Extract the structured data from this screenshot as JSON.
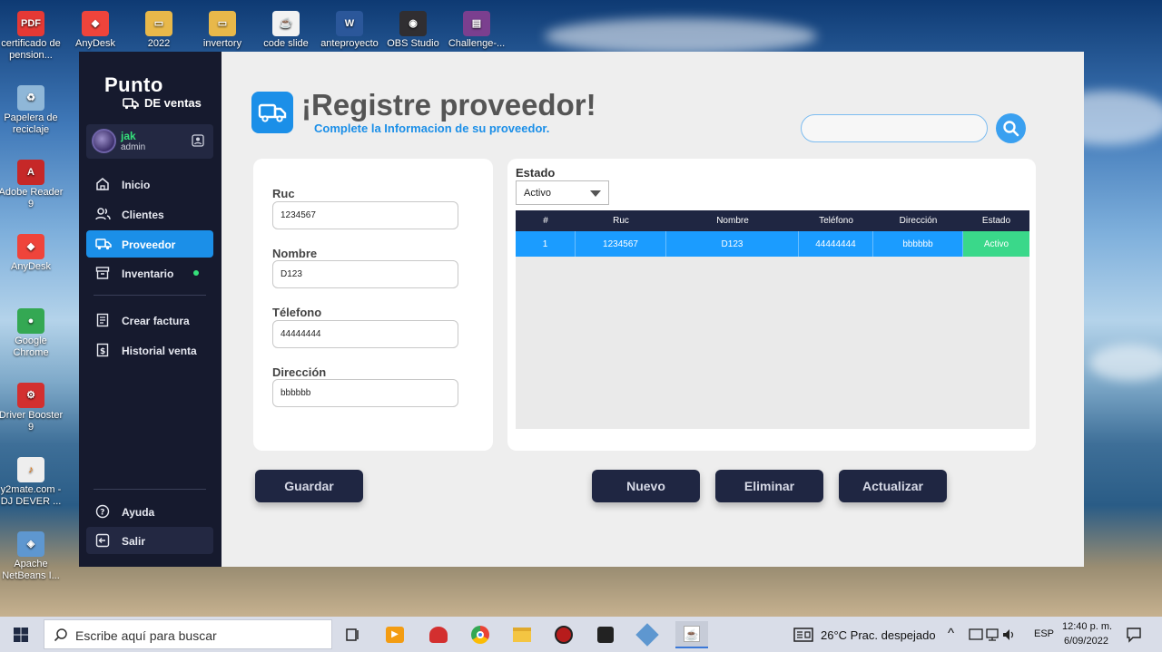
{
  "desktop_icons": [
    {
      "label": "certificado de pension...",
      "icon": "pdf-icon",
      "color": "#e53935",
      "glyph": "PDF"
    },
    {
      "label": "AnyDesk",
      "icon": "anydesk-icon",
      "color": "#ef443b",
      "glyph": "◆"
    },
    {
      "label": "2022",
      "icon": "folder-icon",
      "color": "#e8b84a",
      "glyph": "▭"
    },
    {
      "label": "invertory",
      "icon": "folder-icon",
      "color": "#e8b84a",
      "glyph": "▭"
    },
    {
      "label": "code slide",
      "icon": "java-icon",
      "color": "#f2f2f2",
      "glyph": "☕"
    },
    {
      "label": "anteproyecto",
      "icon": "word-icon",
      "color": "#2b579a",
      "glyph": "W"
    },
    {
      "label": "OBS Studio",
      "icon": "obs-icon",
      "color": "#302e31",
      "glyph": "◉"
    },
    {
      "label": "Challenge-...",
      "icon": "winrar-icon",
      "color": "#7b3f8f",
      "glyph": "▤"
    },
    {
      "label": "Papelera de reciclaje",
      "icon": "recycle-bin-icon",
      "color": "#8fb7d8",
      "glyph": "♻"
    },
    {
      "label": "Adobe Reader 9",
      "icon": "adobe-reader-icon",
      "color": "#c62828",
      "glyph": "A"
    },
    {
      "label": "AnyDesk",
      "icon": "anydesk-icon",
      "color": "#ef443b",
      "glyph": "◆"
    },
    {
      "label": "Google Chrome",
      "icon": "chrome-icon",
      "color": "#34a853",
      "glyph": "●"
    },
    {
      "label": "Driver Booster 9",
      "icon": "driver-booster-icon",
      "color": "#d32f2f",
      "glyph": "⚙"
    },
    {
      "label": "y2mate.com - DJ DEVER ...",
      "icon": "mp3-icon",
      "color": "#eeeeee",
      "glyph": "♪"
    },
    {
      "label": "Apache NetBeans I...",
      "icon": "netbeans-icon",
      "color": "#5e97d0",
      "glyph": "◈"
    }
  ],
  "app": {
    "brand": "Punto",
    "brand_sub": "DE ventas",
    "user": {
      "name": "jak",
      "role": "admin"
    },
    "nav": [
      {
        "label": "Inicio",
        "icon": "home-icon"
      },
      {
        "label": "Clientes",
        "icon": "users-icon"
      },
      {
        "label": "Proveedor",
        "icon": "truck-icon",
        "active": true
      },
      {
        "label": "Inventario",
        "icon": "archive-icon"
      },
      {
        "label": "Crear factura",
        "icon": "invoice-icon"
      },
      {
        "label": "Historial venta",
        "icon": "dollar-doc-icon"
      },
      {
        "label": "Ayuda",
        "icon": "help-icon"
      },
      {
        "label": "Salir",
        "icon": "logout-icon"
      }
    ],
    "title": "¡Registre proveedor!",
    "subtitle": "Complete la Informacion de su proveedor.",
    "search": {
      "value": ""
    },
    "form": {
      "ruc": {
        "label": "Ruc",
        "value": "1234567"
      },
      "nombre": {
        "label": "Nombre",
        "value": "D123"
      },
      "telefono": {
        "label": "Télefono",
        "value": "44444444"
      },
      "direccion": {
        "label": "Dirección",
        "value": "bbbbbb"
      }
    },
    "estado": {
      "label": "Estado",
      "selected": "Activo"
    },
    "table": {
      "columns": [
        "#",
        "Ruc",
        "Nombre",
        "Teléfono",
        "Dirección",
        "Estado"
      ],
      "rows": [
        [
          "1",
          "1234567",
          "D123",
          "44444444",
          "bbbbbb",
          "Activo"
        ]
      ]
    },
    "buttons": {
      "guardar": "Guardar",
      "nuevo": "Nuevo",
      "eliminar": "Eliminar",
      "actualizar": "Actualizar"
    },
    "colors": {
      "accent": "#1b8fe8",
      "sidebar": "#161a2e",
      "button": "#1f2642",
      "active_status": "#3ad88a"
    }
  },
  "taskbar": {
    "search_placeholder": "Escribe aquí para buscar",
    "weather": "26°C  Prac. despejado",
    "language": "ESP",
    "time": "12:40 p. m.",
    "date": "6/09/2022"
  }
}
